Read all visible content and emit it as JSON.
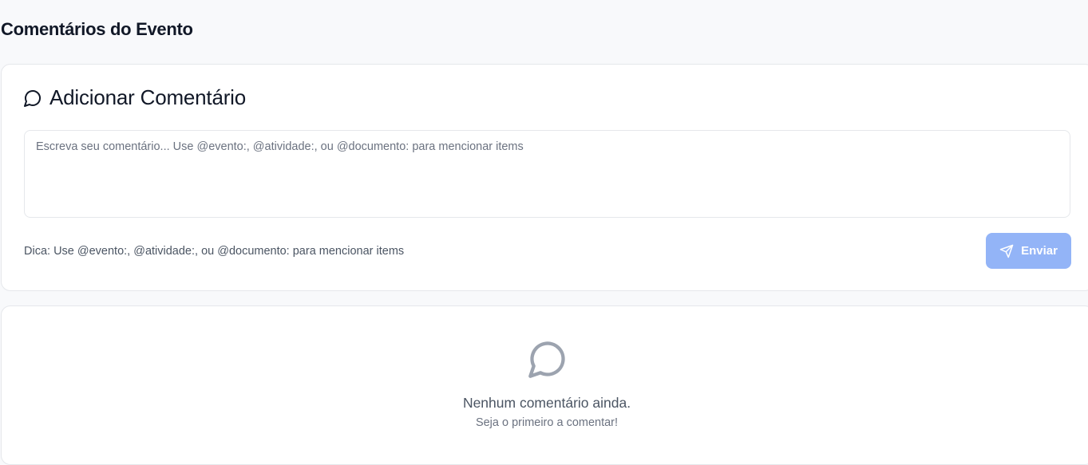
{
  "page": {
    "title": "Comentários do Evento"
  },
  "add_comment": {
    "heading": "Adicionar Comentário",
    "heading_icon": "message-circle-icon",
    "input": {
      "value": "",
      "placeholder": "Escreva seu comentário... Use @evento:, @atividade:, ou @documento: para mencionar items"
    },
    "hint": "Dica: Use @evento:, @atividade:, ou @documento: para mencionar items",
    "send_button": {
      "label": "Enviar",
      "icon": "send-icon",
      "disabled": true
    }
  },
  "empty_state": {
    "icon": "message-circle-icon",
    "title": "Nenhum comentário ainda.",
    "subtitle": "Seja o primeiro a comentar!"
  },
  "colors": {
    "background": "#f8f9fb",
    "card": "#ffffff",
    "border": "#e5e7eb",
    "button_disabled": "#93b4f7",
    "muted_text": "#6b7280"
  }
}
